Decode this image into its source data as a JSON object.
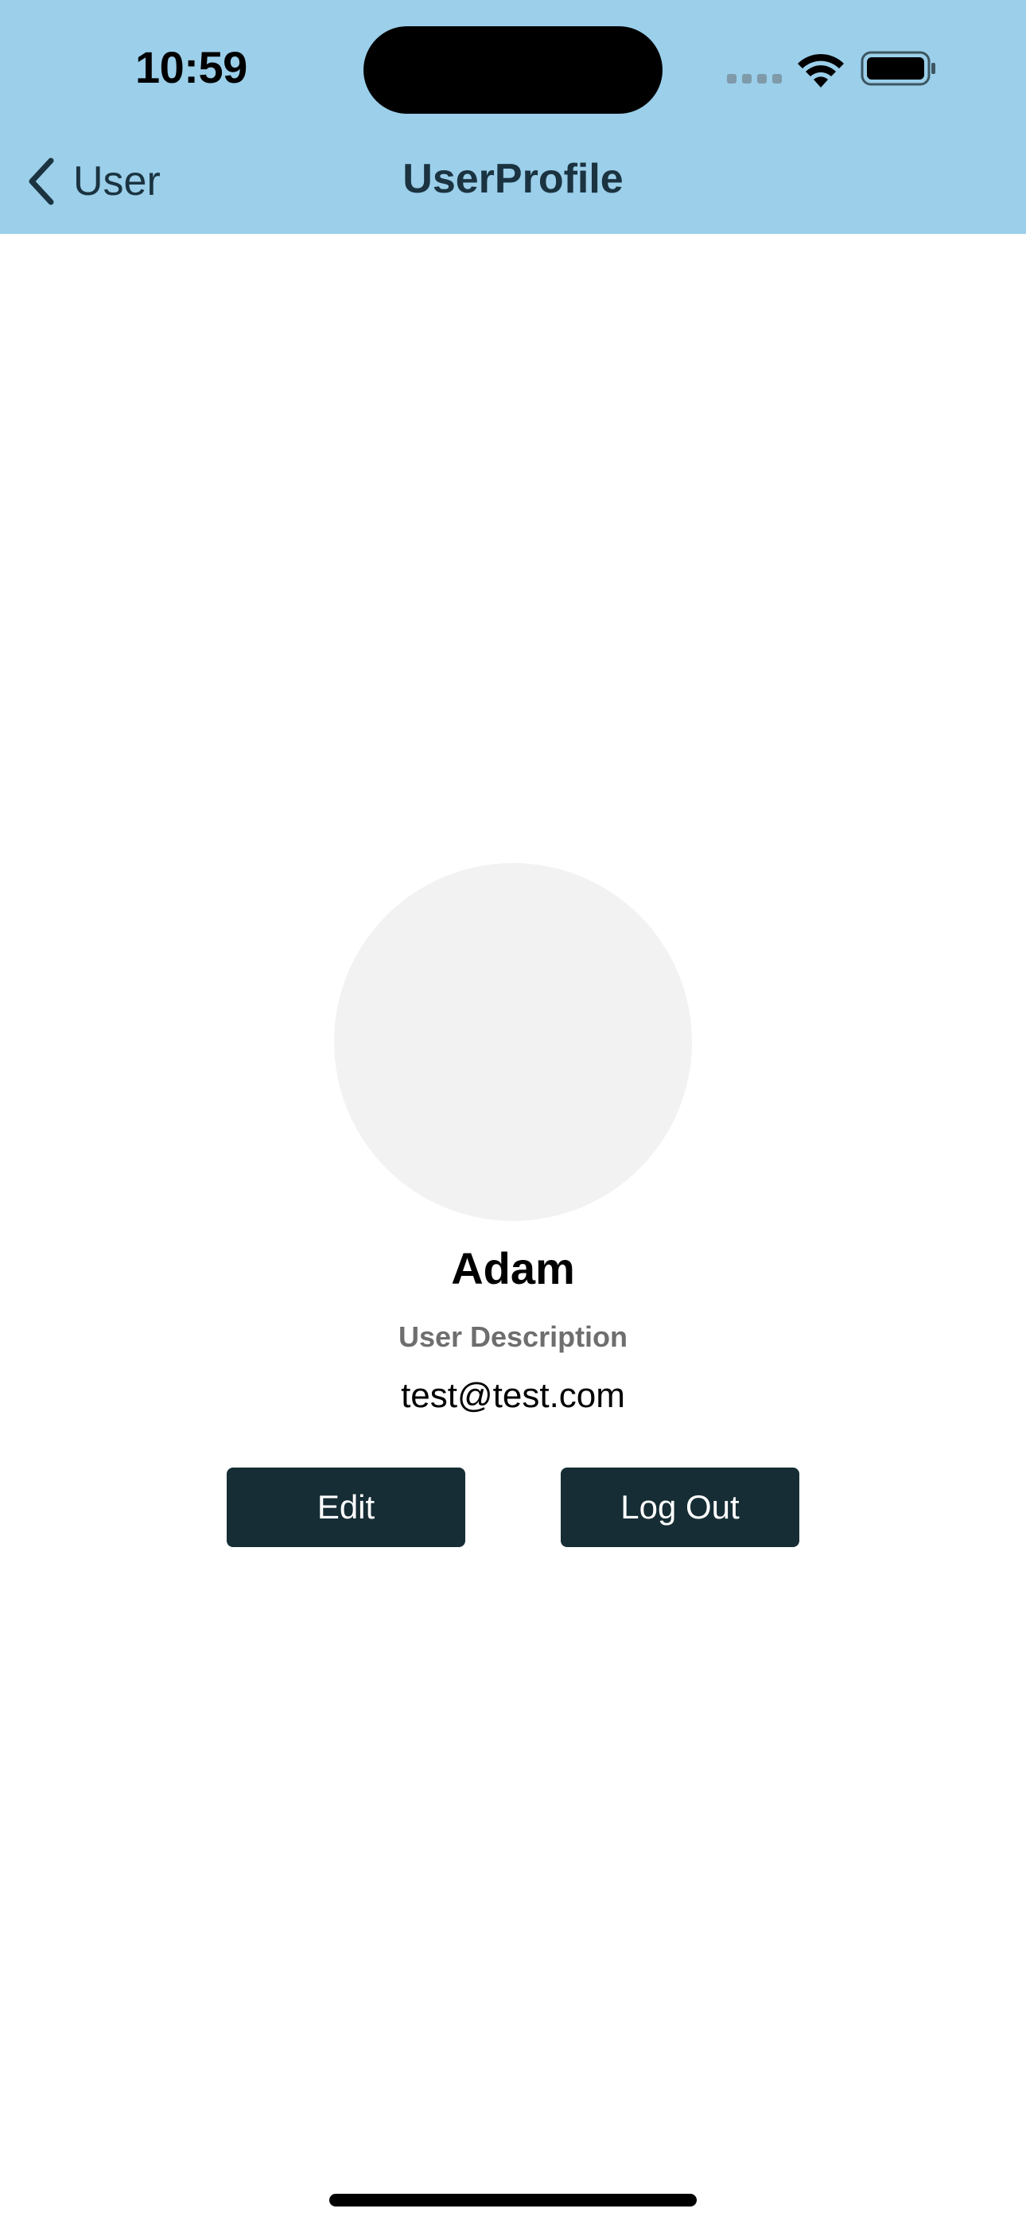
{
  "status_bar": {
    "time": "10:59",
    "icons": [
      "signal-icon",
      "wifi-icon",
      "battery-icon"
    ]
  },
  "nav": {
    "back_label": "User",
    "back_icon": "chevron-left-icon",
    "title": "UserProfile"
  },
  "profile": {
    "name": "Adam",
    "description": "User Description",
    "email": "test@test.com"
  },
  "actions": {
    "edit_label": "Edit",
    "logout_label": "Log Out"
  },
  "colors": {
    "header_background": "#9bcfea",
    "nav_text": "#1b3340",
    "button_background": "#162d35",
    "avatar_placeholder": "#f2f2f2",
    "description_text": "#6e6e6e"
  }
}
